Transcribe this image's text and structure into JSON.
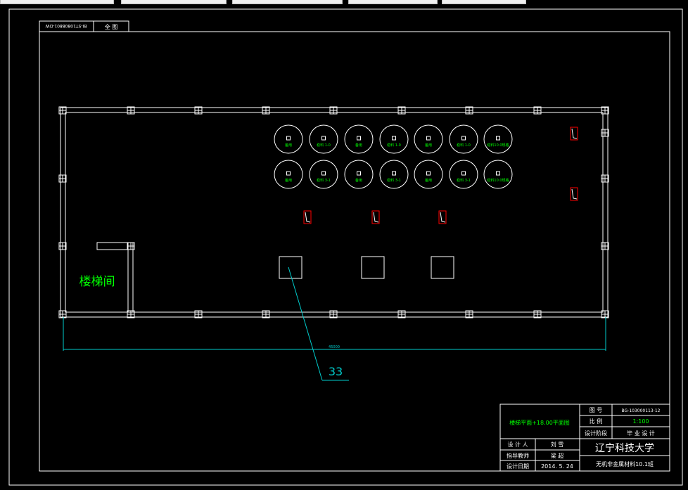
{
  "drawing": {
    "code_tab": "BI-ST10808801-DW",
    "full_drawing_tab": "全 图",
    "room_label": "楼梯间",
    "dimension": "45000",
    "leader_number": "33",
    "tanks_row1": [
      "备用",
      "稳料 1-0",
      "备用",
      "稳料 1-0",
      "备用",
      "稳料 1-0",
      "稳料10.0规格"
    ],
    "tanks_row2": [
      "备用",
      "稳料 3-1",
      "备用",
      "稳料 3-1",
      "备用",
      "稳料 3-1",
      "稳料10.0规格"
    ]
  },
  "title_block": {
    "title": "楼梯平面+18.00平面图",
    "drawing_no_label": "图 号",
    "drawing_no": "BG-103000113-12",
    "scale_label": "比 例",
    "scale": "1:100",
    "stage_label": "设计阶段",
    "stage": "毕 业 设 计",
    "designer_label": "设 计 人",
    "designer": "刘 雪",
    "advisor_label": "指导教师",
    "advisor": "梁 超",
    "date_label": "设计日期",
    "date": "2014. 5. 24",
    "school": "辽宁科技大学",
    "class": "无机非金属材料10.1班"
  },
  "colors": {
    "lines": "#ffffff",
    "text_green": "#00ff00",
    "cyan": "#00cccc",
    "red": "#ff0000"
  }
}
